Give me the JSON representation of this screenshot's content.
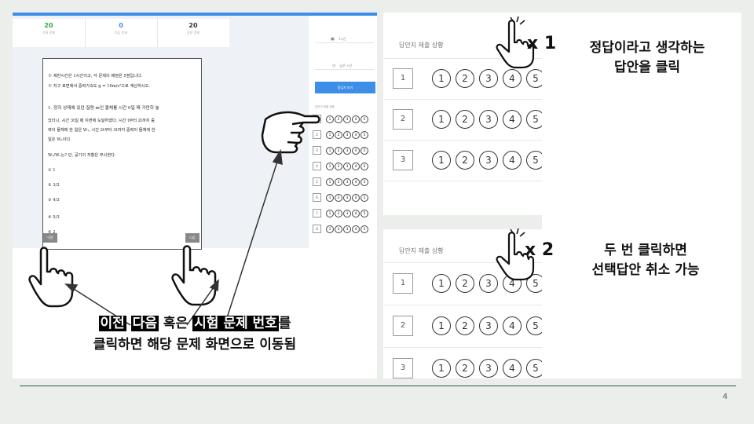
{
  "exam_ui": {
    "stats": [
      {
        "value": "20",
        "label": "전체 문제",
        "color": "#2daa3a"
      },
      {
        "value": "0",
        "label": "미답 문제",
        "color": "#3d8ee8"
      },
      {
        "value": "20",
        "label": "답한 문제",
        "color": "#333333"
      }
    ],
    "paper_lines": [
      "※ 제한시간은 1시간이고, 각 문제의 배점은 5점입니다.",
      "※ 지구 표면에서 중력가속도 g = 10m/s²으로 계산하시오.",
      "1. 정지 상태에 있던 질량 m인 물체를 시간 0일 때 가만히 놓",
      "았더니, 시간 3t일 때 지면에 도달하였다. 시간 t부터 2t까지 중",
      "력이 물체에 한 일은 W₁, 시간 2t부터 3t까지 중력이 물체에 한",
      "일은 W₂이다.",
      "W₂/W₁는? 단, 공기의 저항은 무시한다."
    ],
    "choices": [
      "① 1",
      "② 3/2",
      "③ 4/3",
      "④ 5/3",
      "⑤ 2"
    ],
    "prev_label": "이전",
    "next_label": "다음",
    "sidebar": {
      "timer_label": "1시간",
      "remain_label": "남은 시간",
      "submit_label": "정답지 보기",
      "list_title": "답안지 제출 상황",
      "questions": [
        "1",
        "2",
        "3",
        "4",
        "5",
        "6",
        "7",
        "8"
      ]
    }
  },
  "left_caption": {
    "line1": [
      {
        "text": "이전",
        "highlight": true
      },
      {
        "text": " ",
        "highlight": false
      },
      {
        "text": "다음",
        "highlight": true
      },
      {
        "text": " 혹은 ",
        "highlight": false
      },
      {
        "text": "시험 문제 번호",
        "highlight": true
      },
      {
        "text": "를",
        "highlight": false
      }
    ],
    "line2": "클릭하면 해당 문제 화면으로 이동됨"
  },
  "answer_demo": {
    "title": "답안지 제출 상황",
    "rows": [
      "1",
      "2",
      "3"
    ],
    "options": [
      "1",
      "2",
      "3",
      "4",
      "5"
    ]
  },
  "single_click": {
    "multiplier": "x 1",
    "note_line1": "정답이라고 생각하는",
    "note_line2": "답안을 클릭"
  },
  "double_click": {
    "multiplier": "x 2",
    "note_line1": "두 번 클릭하면",
    "note_line2": "선택답안 취소 가능"
  },
  "page_number": "4",
  "colors": {
    "accent_blue": "#3d8ee8",
    "bottom_rule": "#2c5c4a"
  }
}
